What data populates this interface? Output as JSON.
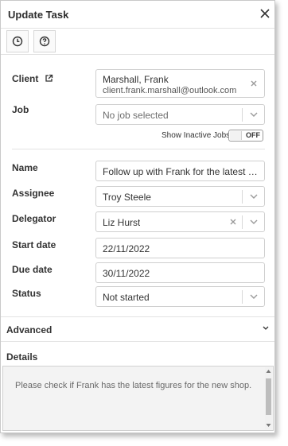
{
  "dialog": {
    "title": "Update Task"
  },
  "toolbar": {
    "history_icon": "clock-icon",
    "help_icon": "question-circle-icon"
  },
  "form": {
    "client": {
      "label": "Client",
      "name": "Marshall, Frank",
      "email": "client.frank.marshall@outlook.com"
    },
    "job": {
      "label": "Job",
      "placeholder": "No job selected"
    },
    "show_inactive": {
      "label": "Show Inactive Jobs",
      "state": "OFF"
    },
    "name": {
      "label": "Name",
      "value": "Follow up with Frank for the latest fig..."
    },
    "assignee": {
      "label": "Assignee",
      "value": "Troy Steele"
    },
    "delegator": {
      "label": "Delegator",
      "value": "Liz Hurst"
    },
    "start_date": {
      "label": "Start date",
      "value": "22/11/2022"
    },
    "due_date": {
      "label": "Due date",
      "value": "30/11/2022"
    },
    "status": {
      "label": "Status",
      "value": "Not started"
    }
  },
  "advanced": {
    "label": "Advanced"
  },
  "details": {
    "label": "Details",
    "text": "Please check if Frank has the latest figures for the new shop."
  },
  "colors": {
    "border": "#cfcfcf",
    "text": "#333333",
    "muted": "#6d6d6d",
    "details_bg": "#f3f3f3"
  }
}
